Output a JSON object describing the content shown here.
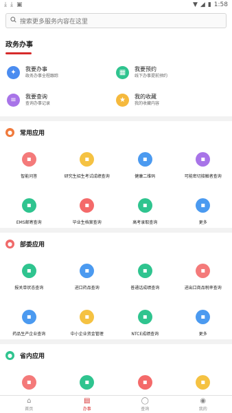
{
  "statusbar": {
    "time": "1:58",
    "notif_icons": [
      "download-icon",
      "download-icon",
      "app-icon"
    ]
  },
  "search": {
    "placeholder": "搜索更多服务内容在这里"
  },
  "gov": {
    "title": "政务办事",
    "items": [
      {
        "title": "我要办事",
        "sub": "政务办事全程跟踪",
        "color": "#4b8cf0",
        "icon": "pin-icon"
      },
      {
        "title": "我要预约",
        "sub": "线下办事提前预约",
        "color": "#2fc48f",
        "icon": "calendar-icon"
      },
      {
        "title": "我要查询",
        "sub": "查询办事记录",
        "color": "#a874e8",
        "icon": "doc-icon"
      },
      {
        "title": "我的收藏",
        "sub": "我的收藏内容",
        "color": "#f5b93d",
        "icon": "star-icon"
      }
    ]
  },
  "sections": [
    {
      "title": "常用应用",
      "color": "#f07a3c",
      "apps": [
        {
          "label": "智能问答",
          "color": "#f47a7a"
        },
        {
          "label": "研究生招生考试成绩查询",
          "color": "#f5c242"
        },
        {
          "label": "健康二维码",
          "color": "#4b9af0"
        },
        {
          "label": "可能密切接触者查询",
          "color": "#a874e8"
        },
        {
          "label": "EMS邮寄查询",
          "color": "#2fc48f"
        },
        {
          "label": "毕业生档案查询",
          "color": "#f46a6a"
        },
        {
          "label": "高考录取查询",
          "color": "#2fc48f"
        },
        {
          "label": "更多",
          "color": "#4b9af0"
        }
      ]
    },
    {
      "title": "部委应用",
      "color": "#f06a6a",
      "apps": [
        {
          "label": "报关单状态查询",
          "color": "#2fc48f"
        },
        {
          "label": "进口药品查询",
          "color": "#4b9af0"
        },
        {
          "label": "普通话成绩查询",
          "color": "#2fc48f"
        },
        {
          "label": "进出口商品税率查询",
          "color": "#f47a7a"
        },
        {
          "label": "药品生产企业查询",
          "color": "#4b9af0"
        },
        {
          "label": "中小企业资金管理",
          "color": "#f5c242"
        },
        {
          "label": "NTCE成绩查询",
          "color": "#2fc48f"
        },
        {
          "label": "更多",
          "color": "#4b9af0"
        }
      ]
    },
    {
      "title": "省内应用",
      "color": "#2fc48f",
      "apps": [
        {
          "label": "",
          "color": "#f47a7a"
        },
        {
          "label": "",
          "color": "#2fc48f"
        },
        {
          "label": "",
          "color": "#f46a6a"
        },
        {
          "label": "",
          "color": "#f5c242"
        }
      ]
    }
  ],
  "tabs": [
    {
      "label": "首页",
      "icon": "home-icon",
      "active": false
    },
    {
      "label": "办事",
      "icon": "briefcase-icon",
      "active": true
    },
    {
      "label": "查询",
      "icon": "search-icon",
      "active": false
    },
    {
      "label": "我的",
      "icon": "user-icon",
      "active": false
    }
  ]
}
